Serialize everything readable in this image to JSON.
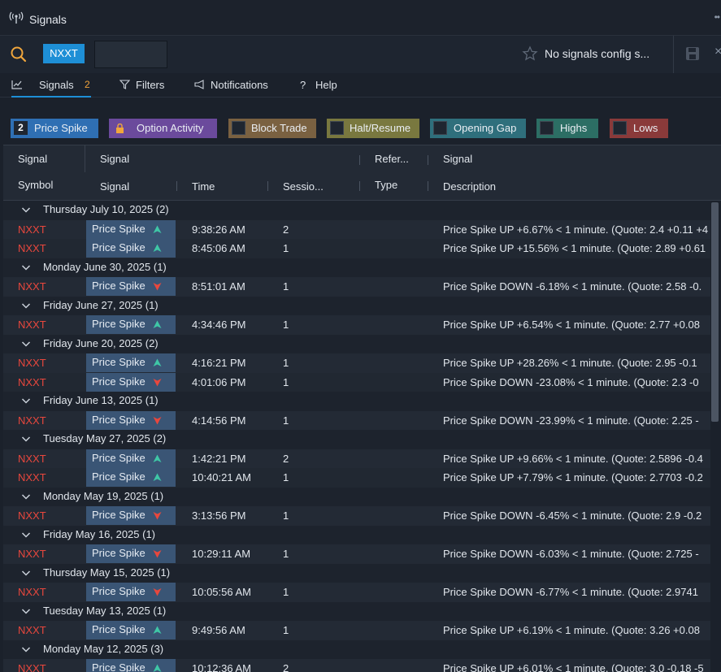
{
  "window": {
    "title": "Signals",
    "more": "••"
  },
  "search": {
    "symbol": "NXXT",
    "input_value": "",
    "config_text": "No signals config s...",
    "close": "×"
  },
  "tabs": [
    {
      "label": "Signals",
      "count": "2"
    },
    {
      "label": "Filters"
    },
    {
      "label": "Notifications"
    },
    {
      "label": "Help"
    }
  ],
  "chips": [
    {
      "label": "Price Spike",
      "count": "2",
      "color": "#2f6fb3"
    },
    {
      "label": "Option Activity",
      "color": "#6b4a9c"
    },
    {
      "label": "Block Trade",
      "color": "#7a6141"
    },
    {
      "label": "Halt/Resume",
      "color": "#79783f"
    },
    {
      "label": "Opening Gap",
      "color": "#2f6f7c"
    },
    {
      "label": "Highs",
      "color": "#2c6e64"
    },
    {
      "label": "Lows",
      "color": "#8a3a3a"
    }
  ],
  "columns": {
    "top": [
      "Signal",
      "Signal",
      "Refer...",
      "Signal"
    ],
    "bottom": [
      "Symbol",
      "Signal",
      "Time",
      "Sessio...",
      "Type",
      "Description"
    ]
  },
  "colors": {
    "up": "#3fc7a6",
    "down": "#e8473d",
    "symbol": "#e8473d",
    "accent": "#1e8fd6"
  },
  "groups": [
    {
      "label": "Thursday July 10, 2025 (2)",
      "rows": [
        {
          "symbol": "NXXT",
          "signal": "Price Spike",
          "dir": "up",
          "time": "9:38:26 AM",
          "session": "2",
          "desc": "Price Spike UP +6.67% < 1 minute. (Quote: 2.4 +0.11 +4"
        },
        {
          "symbol": "NXXT",
          "signal": "Price Spike",
          "dir": "up",
          "time": "8:45:06 AM",
          "session": "1",
          "desc": "Price Spike UP +15.56% < 1 minute. (Quote: 2.89 +0.61"
        }
      ]
    },
    {
      "label": "Monday June 30, 2025 (1)",
      "rows": [
        {
          "symbol": "NXXT",
          "signal": "Price Spike",
          "dir": "down",
          "time": "8:51:01 AM",
          "session": "1",
          "desc": "Price Spike DOWN -6.18% < 1 minute. (Quote: 2.58 -0."
        }
      ]
    },
    {
      "label": "Friday June 27, 2025 (1)",
      "rows": [
        {
          "symbol": "NXXT",
          "signal": "Price Spike",
          "dir": "up",
          "time": "4:34:46 PM",
          "session": "1",
          "desc": "Price Spike UP +6.54% < 1 minute. (Quote: 2.77 +0.08"
        }
      ]
    },
    {
      "label": "Friday June 20, 2025 (2)",
      "rows": [
        {
          "symbol": "NXXT",
          "signal": "Price Spike",
          "dir": "up",
          "time": "4:16:21 PM",
          "session": "1",
          "desc": "Price Spike UP +28.26% < 1 minute. (Quote: 2.95 -0.1"
        },
        {
          "symbol": "NXXT",
          "signal": "Price Spike",
          "dir": "down",
          "time": "4:01:06 PM",
          "session": "1",
          "desc": "Price Spike DOWN -23.08% < 1 minute. (Quote: 2.3 -0"
        }
      ]
    },
    {
      "label": "Friday June 13, 2025 (1)",
      "rows": [
        {
          "symbol": "NXXT",
          "signal": "Price Spike",
          "dir": "down",
          "time": "4:14:56 PM",
          "session": "1",
          "desc": "Price Spike DOWN -23.99% < 1 minute. (Quote: 2.25 -"
        }
      ]
    },
    {
      "label": "Tuesday May 27, 2025 (2)",
      "rows": [
        {
          "symbol": "NXXT",
          "signal": "Price Spike",
          "dir": "up",
          "time": "1:42:21 PM",
          "session": "2",
          "desc": "Price Spike UP +9.66% < 1 minute. (Quote: 2.5896 -0.4"
        },
        {
          "symbol": "NXXT",
          "signal": "Price Spike",
          "dir": "up",
          "time": "10:40:21 AM",
          "session": "1",
          "desc": "Price Spike UP +7.79% < 1 minute. (Quote: 2.7703 -0.2"
        }
      ]
    },
    {
      "label": "Monday May 19, 2025 (1)",
      "rows": [
        {
          "symbol": "NXXT",
          "signal": "Price Spike",
          "dir": "down",
          "time": "3:13:56 PM",
          "session": "1",
          "desc": "Price Spike DOWN -6.45% < 1 minute. (Quote: 2.9 -0.2"
        }
      ]
    },
    {
      "label": "Friday May 16, 2025 (1)",
      "rows": [
        {
          "symbol": "NXXT",
          "signal": "Price Spike",
          "dir": "down",
          "time": "10:29:11 AM",
          "session": "1",
          "desc": "Price Spike DOWN -6.03% < 1 minute. (Quote: 2.725 -"
        }
      ]
    },
    {
      "label": "Thursday May 15, 2025 (1)",
      "rows": [
        {
          "symbol": "NXXT",
          "signal": "Price Spike",
          "dir": "down",
          "time": "10:05:56 AM",
          "session": "1",
          "desc": "Price Spike DOWN -6.77% < 1 minute. (Quote: 2.9741"
        }
      ]
    },
    {
      "label": "Tuesday May 13, 2025 (1)",
      "rows": [
        {
          "symbol": "NXXT",
          "signal": "Price Spike",
          "dir": "up",
          "time": "9:49:56 AM",
          "session": "1",
          "desc": "Price Spike UP +6.19% < 1 minute. (Quote: 3.26 +0.08"
        }
      ]
    },
    {
      "label": "Monday May 12, 2025 (3)",
      "rows": [
        {
          "symbol": "NXXT",
          "signal": "Price Spike",
          "dir": "up",
          "time": "10:12:36 AM",
          "session": "2",
          "desc": "Price Spike UP +6.01% < 1 minute. (Quote: 3.0 -0.18 -5"
        }
      ]
    }
  ]
}
